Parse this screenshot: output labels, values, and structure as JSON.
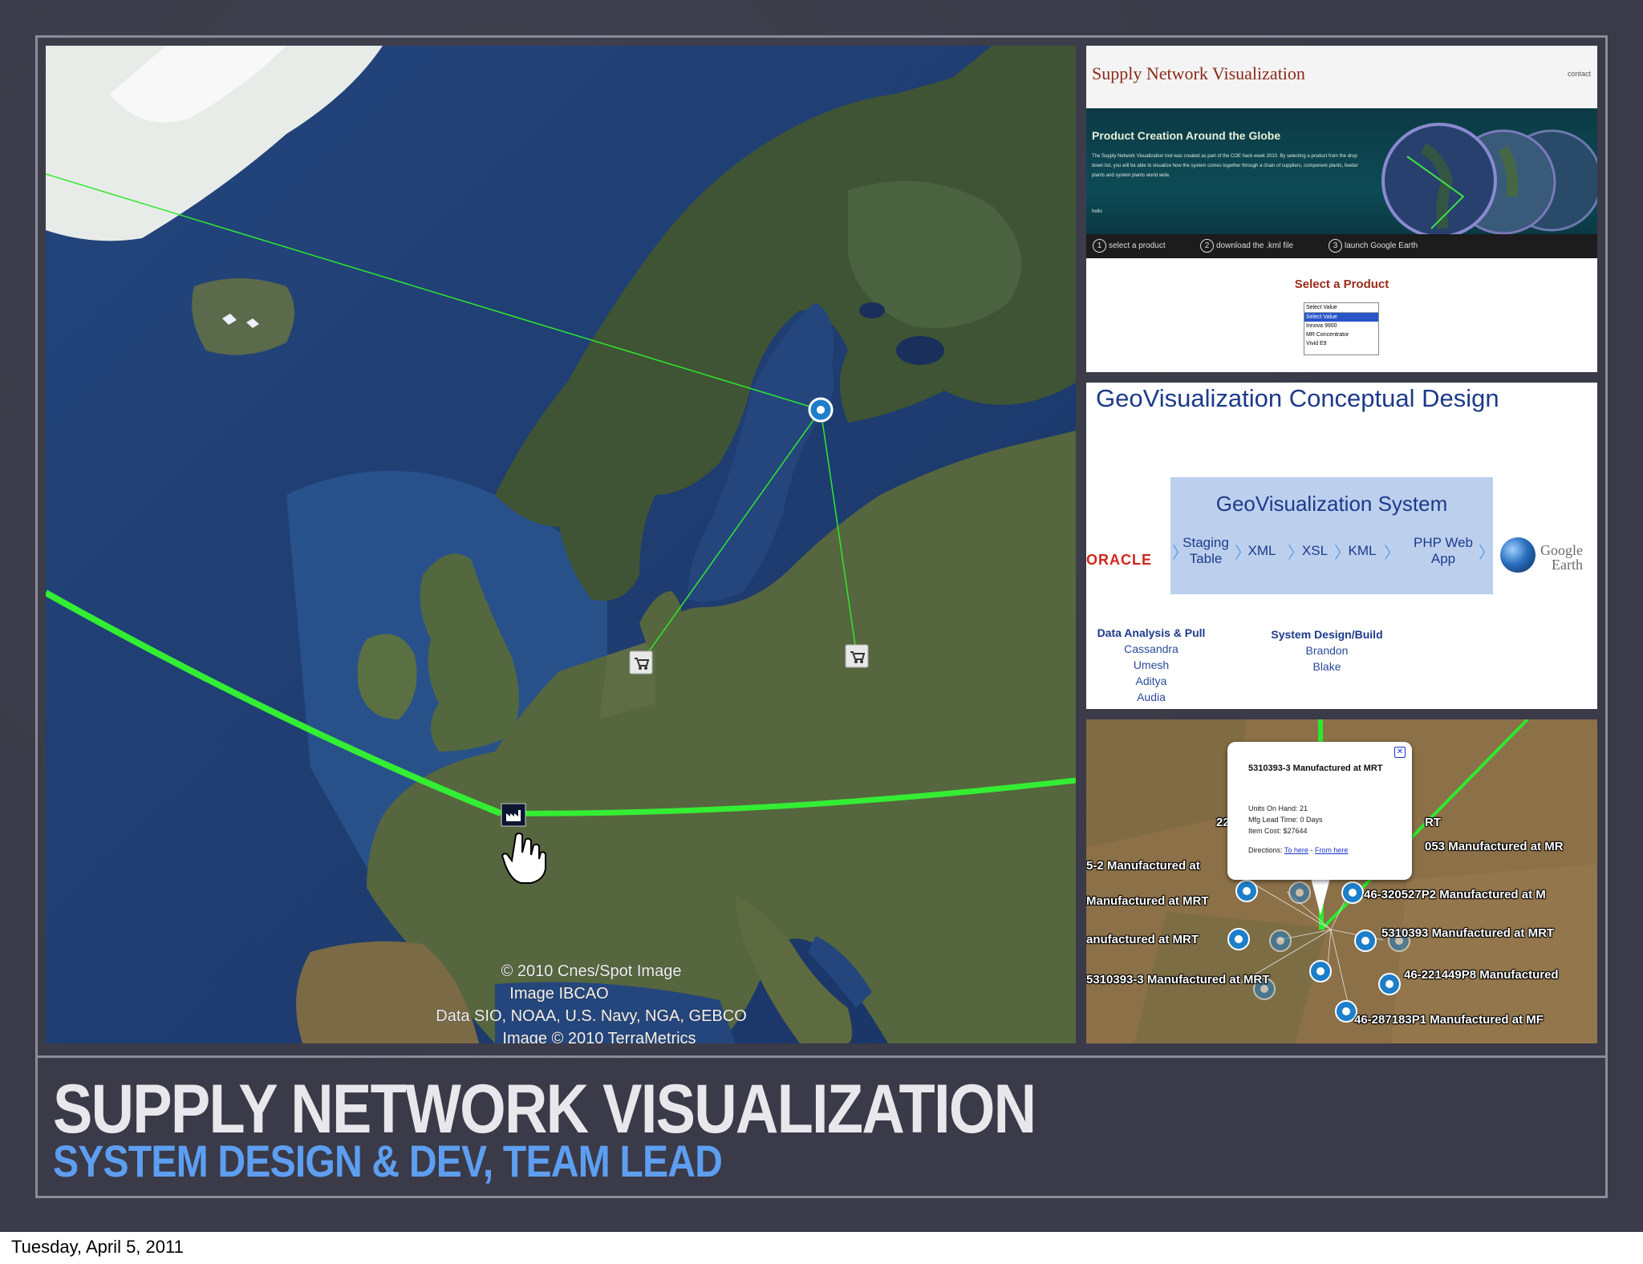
{
  "slide": {
    "title": "SUPPLY NETWORK VISUALIZATION",
    "subtitle": "SYSTEM DESIGN & DEV, TEAM LEAD",
    "footer_date": "Tuesday, April 5, 2011",
    "colors": {
      "background": "#3a3a48",
      "border": "#8c8c98",
      "title": "#e8e8ec",
      "subtitle": "#5d9ef0"
    }
  },
  "main_map": {
    "credits": [
      "© 2010 Cnes/Spot Image",
      "Image IBCAO",
      "Data SIO, NOAA, U.S. Navy, NGA, GEBCO",
      "Image © 2010 TerraMetrics"
    ],
    "markers": {
      "factory_icon": "gear-icon",
      "cart_icon": "shopping-cart-icon",
      "plant_icon": "factory-icon",
      "cursor_icon": "hand-cursor-icon"
    },
    "route_color": "#2ee82e"
  },
  "website": {
    "title": "Supply Network Visualization",
    "contact": "contact",
    "banner_heading": "Product Creation Around the Globe",
    "banner_text": "The Supply Network Visualization tool was created as part of the COE hack week 2010. By selecting a product from the drop down list, you will be able to visualize how the system comes together through a chain of suppliers, component plants, feeder plants and system plants world wide.",
    "banner_hello": "hello",
    "steps": [
      {
        "num": "1",
        "label": "select a product"
      },
      {
        "num": "2",
        "label": "download the .kml file"
      },
      {
        "num": "3",
        "label": "launch Google Earth"
      }
    ],
    "select_heading": "Select a Product",
    "select_options": [
      "Select Value",
      "Select Value",
      "Innova 9900",
      "MR Concentrator",
      "Vivid E9"
    ]
  },
  "concept": {
    "title": "GeoVisualization Conceptual Design",
    "system_label": "GeoVisualization System",
    "flow": [
      "Staging Table",
      "XML",
      "XSL",
      "KML",
      "PHP Web App"
    ],
    "oracle": "ORACLE",
    "google_earth_top": "Google",
    "google_earth_bottom": "Earth",
    "groups": [
      {
        "heading": "Data Analysis & Pull",
        "members": [
          "Cassandra",
          "Umesh",
          "Aditya",
          "Audia"
        ]
      },
      {
        "heading": "System Design/Build",
        "members": [
          "Brandon",
          "Blake"
        ]
      }
    ]
  },
  "detail_map": {
    "popup_title": "5310393-3 Manufactured at MRT",
    "popup_units": "Units On Hand: 21",
    "popup_lead": "Mfg Lead Time: 0 Days",
    "popup_cost": "Item Cost: $27644",
    "popup_directions": "Directions:",
    "popup_link1": "To here",
    "popup_sep": " - ",
    "popup_link2": "From here",
    "labels": [
      "5-2 Manufactured at",
      "Manufactured at MRT",
      "anufactured at MRT",
      "5310393-3 Manufactured at MRT",
      "053 Manufactured at MR",
      "46-320527P2 Manufactured at M",
      "5310393 Manufactured at MRT",
      "46-221449P8 Manufactured",
      "46-287183P1 Manufactured at MF",
      "22",
      "RT"
    ]
  }
}
